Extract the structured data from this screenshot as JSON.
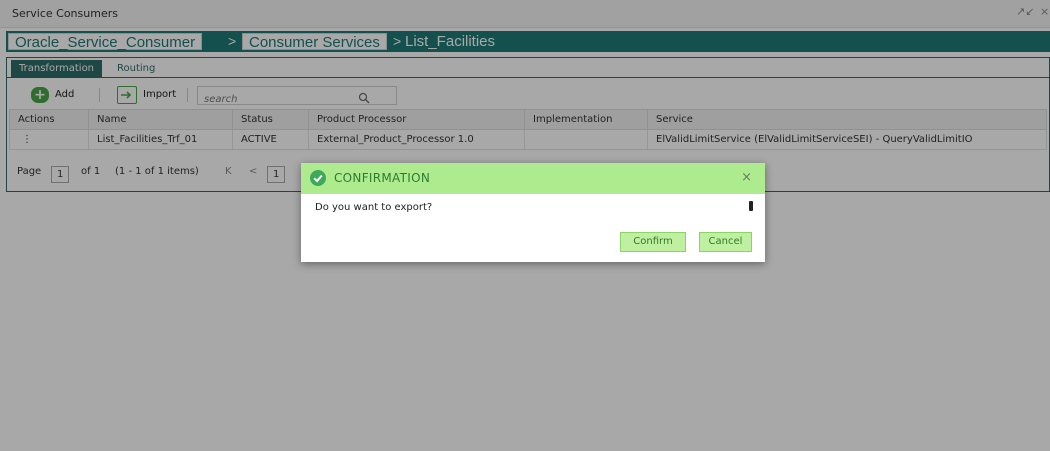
{
  "window": {
    "title": "Service Consumers",
    "restore_glyph": "↗↙",
    "close_glyph": "×"
  },
  "breadcrumb": {
    "items": [
      "Oracle_Service_Consumer",
      "Consumer Services"
    ],
    "separator": ">",
    "current": "List_Facilities"
  },
  "tabs": [
    {
      "label": "Transformation",
      "active": true
    },
    {
      "label": "Routing",
      "active": false
    }
  ],
  "toolbar": {
    "add_label": "Add",
    "import_label": "Import",
    "search_placeholder": "search"
  },
  "table": {
    "columns": [
      "Actions",
      "Name",
      "Status",
      "Product Processor",
      "Implementation",
      "Service"
    ],
    "rows": [
      {
        "actions": "⋮",
        "name": "List_Facilities_Trf_01",
        "status": "ACTIVE",
        "product_processor": "External_Product_Processor 1.0",
        "implementation": "",
        "service": "ElValidLimitService (ElValidLimitServiceSEI) - QueryValidLimitIO"
      }
    ]
  },
  "pager": {
    "page_label": "Page",
    "page_value": "1",
    "of_text": "of 1",
    "items_text": "(1 - 1 of 1 items)",
    "first_glyph": "K",
    "prev_glyph": "<",
    "current_page": "1"
  },
  "dialog": {
    "title": "CONFIRMATION",
    "message": "Do you want to export?",
    "confirm_label": "Confirm",
    "cancel_label": "Cancel",
    "close_glyph": "×"
  },
  "colors": {
    "brand_teal": "#1f7a75",
    "tab_active": "#2e6e6a",
    "dialog_header": "#aeeb8f",
    "success_icon": "#3fa85a"
  }
}
